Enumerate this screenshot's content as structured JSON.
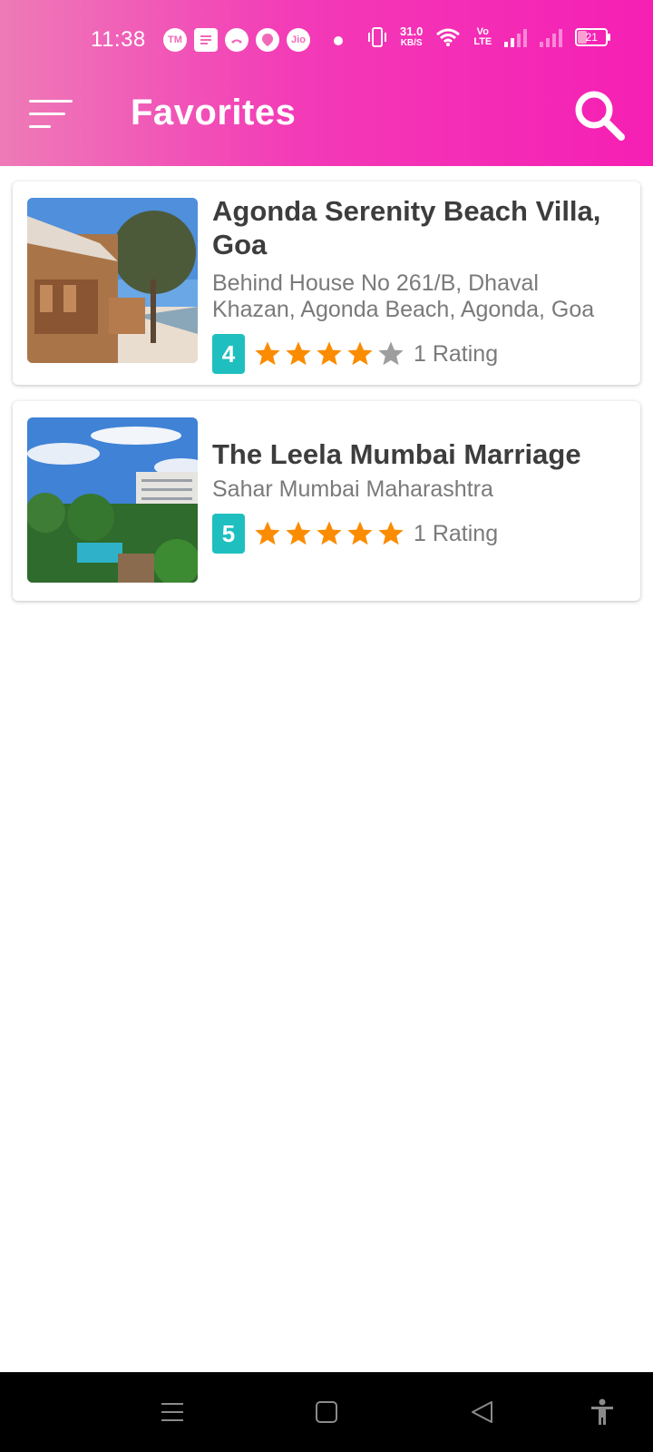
{
  "status_bar": {
    "time": "11:38",
    "left_icons": [
      "TM",
      "news-icon",
      "missed-call-icon",
      "location-icon",
      "Jio"
    ],
    "speed_value": "31.0",
    "speed_unit": "KB/S",
    "volte_top": "Vo",
    "volte_bottom": "LTE",
    "battery_level": "21"
  },
  "app_bar": {
    "title": "Favorites",
    "menu_icon": "hamburger-menu-icon",
    "search_icon": "search-icon"
  },
  "favorites": [
    {
      "name": "Agonda Serenity Beach Villa, Goa",
      "address": "Behind House No 261/B, Dhaval Khazan, Agonda Beach, Agonda, Goa",
      "rating": "4",
      "stars_filled": 4,
      "stars_total": 5,
      "rating_count_text": "1 Rating"
    },
    {
      "name": "The Leela Mumbai Marriage",
      "address": "Sahar Mumbai Maharashtra",
      "rating": "5",
      "stars_filled": 5,
      "stars_total": 5,
      "rating_count_text": "1 Rating"
    }
  ],
  "colors": {
    "header_gradient_start": "#ee7bb7",
    "header_gradient_end": "#f51fb4",
    "rating_badge": "#1fbfc0",
    "star_filled": "#fb8c00",
    "star_empty": "#9e9e9e"
  },
  "nav_bar": {
    "icons": [
      "recents-icon",
      "home-icon",
      "back-icon",
      "accessibility-icon"
    ]
  }
}
